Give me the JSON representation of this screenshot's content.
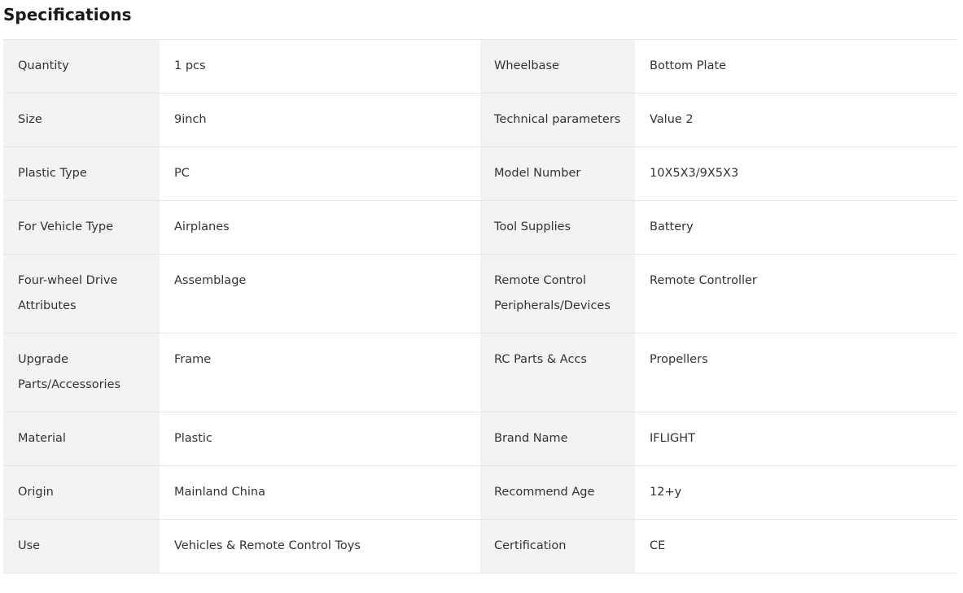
{
  "section": {
    "title": "Specifications"
  },
  "rows": [
    {
      "left_name": "Quantity",
      "left_value": "1 pcs",
      "right_name": "Wheelbase",
      "right_value": "Bottom Plate"
    },
    {
      "left_name": "Size",
      "left_value": "9inch",
      "right_name": "Technical parameters",
      "right_value": "Value 2"
    },
    {
      "left_name": "Plastic Type",
      "left_value": "PC",
      "right_name": "Model Number",
      "right_value": "10X5X3/9X5X3"
    },
    {
      "left_name": "For Vehicle Type",
      "left_value": "Airplanes",
      "right_name": "Tool Supplies",
      "right_value": "Battery"
    },
    {
      "left_name": "Four-wheel Drive Attributes",
      "left_value": "Assemblage",
      "right_name": "Remote Control Peripherals/Devices",
      "right_value": "Remote Controller"
    },
    {
      "left_name": "Upgrade Parts/Accessories",
      "left_value": "Frame",
      "right_name": "RC Parts & Accs",
      "right_value": "Propellers"
    },
    {
      "left_name": "Material",
      "left_value": "Plastic",
      "right_name": "Brand Name",
      "right_value": "IFLIGHT"
    },
    {
      "left_name": "Origin",
      "left_value": "Mainland China",
      "right_name": "Recommend Age",
      "right_value": "12+y"
    },
    {
      "left_name": "Use",
      "left_value": "Vehicles & Remote Control Toys",
      "right_name": "Certification",
      "right_value": "CE"
    }
  ]
}
